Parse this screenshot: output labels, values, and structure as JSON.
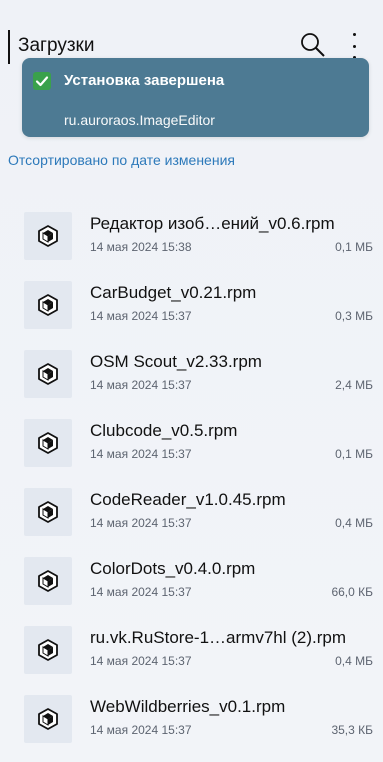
{
  "header": {
    "title": "Загрузки",
    "search_icon": "search-icon",
    "more_icon": "more-vert-icon"
  },
  "toast": {
    "title": "Установка завершена",
    "subtitle": "ru.auroraos.ImageEditor",
    "icon": "check-icon",
    "bg_color": "#4d7a93",
    "check_color": "#3aa14c"
  },
  "sort": {
    "label": "Отсортировано по дате изменения"
  },
  "files": [
    {
      "name": "Редактор изоб…ений_v0.6.rpm",
      "date": "14 мая 2024 15:38",
      "size": "0,1 МБ"
    },
    {
      "name": "CarBudget_v0.21.rpm",
      "date": "14 мая 2024 15:37",
      "size": "0,3 МБ"
    },
    {
      "name": "OSM Scout_v2.33.rpm",
      "date": "14 мая 2024 15:37",
      "size": "2,4 МБ"
    },
    {
      "name": "Clubcode_v0.5.rpm",
      "date": "14 мая 2024 15:37",
      "size": "0,1 МБ"
    },
    {
      "name": "CodeReader_v1.0.45.rpm",
      "date": "14 мая 2024 15:37",
      "size": "0,4 МБ"
    },
    {
      "name": "ColorDots_v0.4.0.rpm",
      "date": "14 мая 2024 15:37",
      "size": "66,0 КБ"
    },
    {
      "name": "ru.vk.RuStore-1…armv7hl (2).rpm",
      "date": "14 мая 2024 15:37",
      "size": "0,4 МБ"
    },
    {
      "name": "WebWildberries_v0.1.rpm",
      "date": "14 мая 2024 15:37",
      "size": "35,3 КБ"
    }
  ]
}
